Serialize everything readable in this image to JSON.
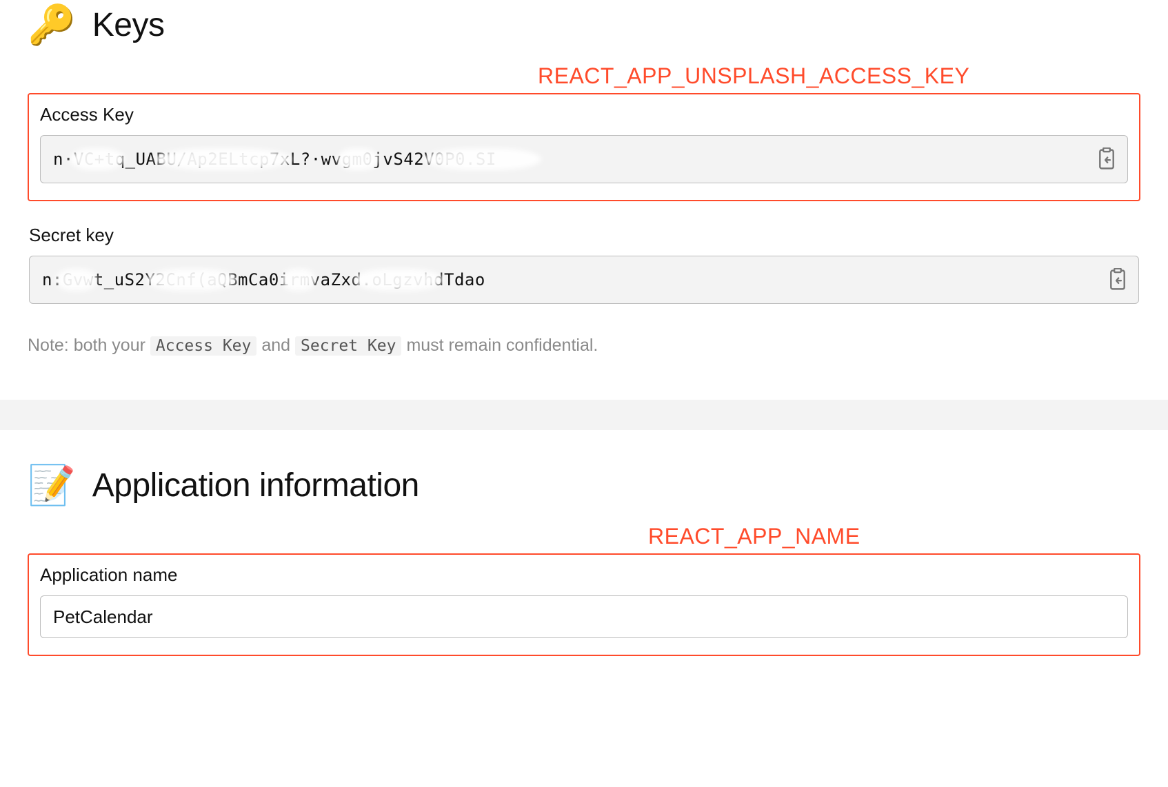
{
  "keys_section": {
    "heading_emoji": "🔑",
    "heading": "Keys",
    "callout": "REACT_APP_UNSPLASH_ACCESS_KEY",
    "access_key": {
      "label": "Access Key",
      "value": "n·VC+tq_UABU/Ap2ELtcp7xL?·wvgm0jvS42V0P0.SI"
    },
    "secret_key": {
      "label": "Secret key",
      "value": "n:Gvwt_uS2Y2Cnf(aQBmCa0irmvaZxd.oLgzvhdTdao"
    },
    "note": {
      "prefix": "Note: both your",
      "chip1": "Access Key",
      "mid": "and",
      "chip2": "Secret Key",
      "suffix": "must remain confidential."
    }
  },
  "app_section": {
    "heading_emoji": "📝",
    "heading": "Application information",
    "callout": "REACT_APP_NAME",
    "app_name": {
      "label": "Application name",
      "value": "PetCalendar"
    }
  }
}
